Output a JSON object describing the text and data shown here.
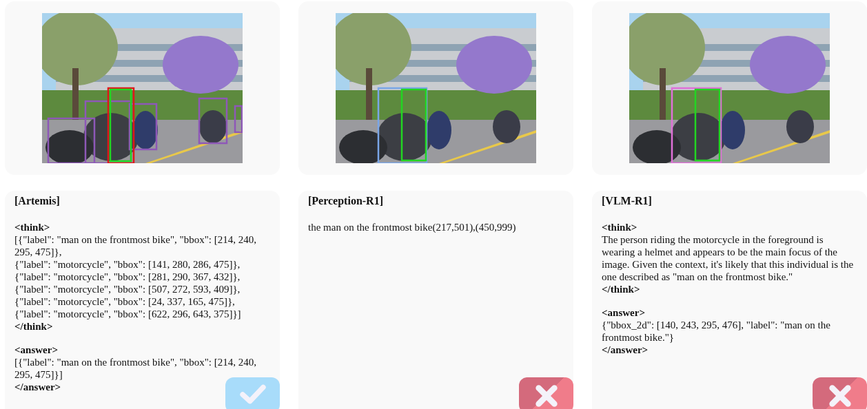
{
  "results": [
    {
      "title": "[Artemis]",
      "correct": true,
      "blocks": [
        {
          "kind": "gap"
        },
        {
          "kind": "tag",
          "text": "<think>"
        },
        {
          "kind": "text",
          "text": "[{\"label\": \"man on the frontmost bike\", \"bbox\": [214, 240, 295, 475]},"
        },
        {
          "kind": "text",
          "text": "{\"label\": \"motorcycle\", \"bbox\": [141, 280, 286, 475]},"
        },
        {
          "kind": "text",
          "text": "{\"label\": \"motorcycle\", \"bbox\": [281, 290, 367, 432]},"
        },
        {
          "kind": "text",
          "text": "{\"label\": \"motorcycle\", \"bbox\": [507, 272, 593, 409]},"
        },
        {
          "kind": "text",
          "text": "{\"label\": \"motorcycle\", \"bbox\": [24, 337, 165, 475]},"
        },
        {
          "kind": "text",
          "text": "{\"label\": \"motorcycle\", \"bbox\": [622, 296, 643, 375]}]"
        },
        {
          "kind": "tag",
          "text": "</think>"
        },
        {
          "kind": "gap"
        },
        {
          "kind": "tag",
          "text": "<answer>"
        },
        {
          "kind": "text",
          "text": "[{\"label\": \"man on the frontmost bike\", \"bbox\": [214, 240, 295, 475]}]"
        },
        {
          "kind": "tag",
          "text": "</answer>"
        }
      ]
    },
    {
      "title": "[Perception-R1]",
      "correct": false,
      "blocks": [
        {
          "kind": "gap"
        },
        {
          "kind": "text",
          "text": "the man on the frontmost bike(217,501),(450,999)"
        }
      ]
    },
    {
      "title": "[VLM-R1]",
      "correct": false,
      "blocks": [
        {
          "kind": "gap"
        },
        {
          "kind": "tag",
          "text": "<think>"
        },
        {
          "kind": "text",
          "text": "The person riding the motorcycle in the foreground is wearing a helmet and appears to be the main focus of the image. Given the context, it's likely that this individual is the one described as \"man on the frontmost bike.\""
        },
        {
          "kind": "tag",
          "text": "</think>"
        },
        {
          "kind": "gap"
        },
        {
          "kind": "tag",
          "text": "<answer>"
        },
        {
          "kind": "text",
          "text": "{\"bbox_2d\": [140, 243, 295, 476], \"label\": \"man on the frontmost bike.\"}"
        },
        {
          "kind": "tag",
          "text": "</answer>"
        }
      ]
    }
  ]
}
